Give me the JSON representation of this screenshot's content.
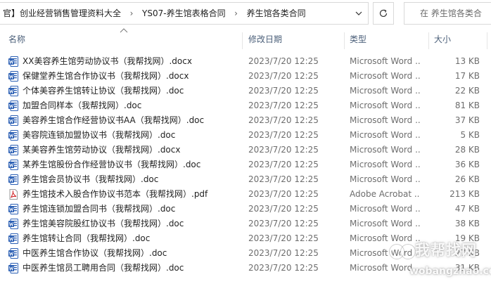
{
  "address_bar": {
    "breadcrumbs": [
      "官】创业经营销售管理资料大全",
      "YS07-养生馆表格合同",
      "养生馆各类合同"
    ]
  },
  "search": {
    "placeholder": "在 养生馆各类合"
  },
  "columns": {
    "name": "名称",
    "date": "修改日期",
    "type": "类型",
    "size": "大小"
  },
  "files": [
    {
      "name": "XX美容养生馆劳动协议书（我帮找网）.docx",
      "date": "2023/7/20 12:25",
      "type": "Microsoft Word ...",
      "size": "13 KB",
      "icon": "word-doc-icon"
    },
    {
      "name": "保健堂养生馆合作协议书（我帮找网）.docx",
      "date": "2023/7/20 12:25",
      "type": "Microsoft Word ...",
      "size": "17 KB",
      "icon": "word-doc-icon"
    },
    {
      "name": "个体美容养生馆转让协议（我帮找网）.doc",
      "date": "2023/7/20 12:25",
      "type": "Microsoft Word ...",
      "size": "22 KB",
      "icon": "word-doc-icon"
    },
    {
      "name": "加盟合同样本（我帮找网）.doc",
      "date": "2023/7/20 12:25",
      "type": "Microsoft Word ...",
      "size": "81 KB",
      "icon": "word-doc-icon"
    },
    {
      "name": "美容养生馆合作经营协议书AA（我帮找网）.doc",
      "date": "2023/7/20 12:25",
      "type": "Microsoft Word ...",
      "size": "37 KB",
      "icon": "word-doc-icon"
    },
    {
      "name": "美容院连锁加盟协议书（我帮找网）.doc",
      "date": "2023/7/20 12:25",
      "type": "Microsoft Word ...",
      "size": "5 KB",
      "icon": "word-doc-icon"
    },
    {
      "name": "某美容养生馆劳动协议（我帮找网）.docx",
      "date": "2023/7/20 12:25",
      "type": "Microsoft Word ...",
      "size": "28 KB",
      "icon": "word-doc-icon"
    },
    {
      "name": "某养生馆股份合作经营协议书（我帮找网）.doc",
      "date": "2023/7/20 12:25",
      "type": "Microsoft Word ...",
      "size": "36 KB",
      "icon": "word-doc-icon"
    },
    {
      "name": "养生馆会员协议书（我帮找网）.doc",
      "date": "2023/7/20 12:25",
      "type": "Microsoft Word ...",
      "size": "26 KB",
      "icon": "word-doc-icon"
    },
    {
      "name": "养生馆技术入股合作协议书范本（我帮找网）.pdf",
      "date": "2023/7/20 12:25",
      "type": "Adobe Acrobat ...",
      "size": "213 KB",
      "icon": "pdf-icon"
    },
    {
      "name": "养生馆连锁加盟合同书（我帮找网）.doc",
      "date": "2023/7/20 12:25",
      "type": "Microsoft Word ...",
      "size": "47 KB",
      "icon": "word-doc-icon"
    },
    {
      "name": "养生馆美容院股红协议书（我帮找网）.doc",
      "date": "2023/7/20 12:25",
      "type": "Microsoft Word ...",
      "size": "38 KB",
      "icon": "word-doc-icon"
    },
    {
      "name": "养生馆转让合同（我帮找网）.doc",
      "date": "2023/7/20 12:25",
      "type": "Microsoft Word ...",
      "size": "19 KB",
      "icon": "word-doc-icon"
    },
    {
      "name": "中医养生馆合作协议（我帮找网）.doc",
      "date": "2023/7/20 12:25",
      "type": "Microsoft Word ...",
      "size": "27 KB",
      "icon": "word-doc-icon"
    },
    {
      "name": "中医养生馆员工聘用合同（我帮找网）.doc",
      "date": "2023/7/20 12:25",
      "type": "Microsoft Word ...",
      "size": "31 KB",
      "icon": "word-doc-icon"
    }
  ],
  "watermark": {
    "main": "我帮找网",
    "sub": "wobangzhao.com"
  },
  "colors": {
    "word_blue": "#2b5fb4",
    "pdf_red": "#d1282b",
    "header_text": "#4c607a"
  }
}
